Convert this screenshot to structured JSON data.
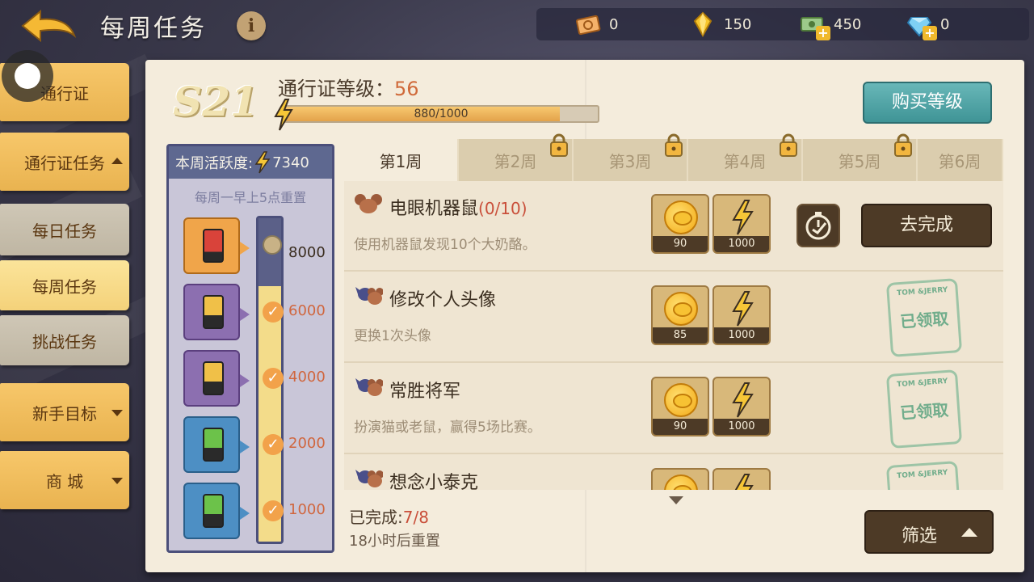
{
  "header": {
    "title": "每周任务",
    "info_icon": "info-icon"
  },
  "currencies": [
    {
      "icon": "ticket-icon",
      "value": "0"
    },
    {
      "icon": "gold-crystal-icon",
      "value": "150"
    },
    {
      "icon": "cash-icon",
      "value": "450"
    },
    {
      "icon": "diamond-icon",
      "value": "0"
    }
  ],
  "sidebar": {
    "items": [
      {
        "label": "通行证"
      },
      {
        "label": "通行证任务"
      },
      {
        "label": "每日任务"
      },
      {
        "label": "每周任务"
      },
      {
        "label": "挑战任务"
      },
      {
        "label": "新手目标"
      },
      {
        "label": "商 城"
      }
    ]
  },
  "pass": {
    "season": "S21",
    "level_label": "通行证等级：",
    "level": "56",
    "xp_text": "880/1000",
    "xp_fraction": 0.88,
    "buy_label": "购买等级"
  },
  "activity": {
    "header_label": "本周活跃度:",
    "header_value": "7340",
    "note": "每周一早上5点重置",
    "milestones": [
      {
        "value": "8000",
        "done": false
      },
      {
        "value": "6000",
        "done": true
      },
      {
        "value": "4000",
        "done": true
      },
      {
        "value": "2000",
        "done": true
      },
      {
        "value": "1000",
        "done": true
      }
    ]
  },
  "tabs": [
    {
      "label": "第1周"
    },
    {
      "label": "第2周"
    },
    {
      "label": "第3周"
    },
    {
      "label": "第4周"
    },
    {
      "label": "第5周"
    },
    {
      "label": "第6周"
    }
  ],
  "tasks": [
    {
      "title": "电眼机器鼠",
      "progress": "(0/10)",
      "desc": "使用机器鼠发现10个大奶酪。",
      "coin": "90",
      "energy": "1000",
      "action": "去完成"
    },
    {
      "title": "修改个人头像",
      "progress": "",
      "desc": "更换1次头像",
      "coin": "85",
      "energy": "1000",
      "stamp_top": "TOM &JERRY",
      "stamp": "已领取"
    },
    {
      "title": "常胜将军",
      "progress": "",
      "desc": "扮演猫或老鼠，赢得5场比赛。",
      "coin": "90",
      "energy": "1000",
      "stamp_top": "TOM &JERRY",
      "stamp": "已领取"
    },
    {
      "title": "想念小泰克",
      "progress": "",
      "desc": "",
      "coin": "",
      "energy": "",
      "stamp_top": "TOM &JERRY",
      "stamp": ""
    }
  ],
  "footer": {
    "done_label": "已完成:",
    "done_value": "7/8",
    "reset": "18小时后重置",
    "filter_label": "筛选"
  },
  "colors": {
    "accent_teal": "#3f9496",
    "button_brown": "#4d3a26",
    "progress_red": "#c94f3a"
  }
}
